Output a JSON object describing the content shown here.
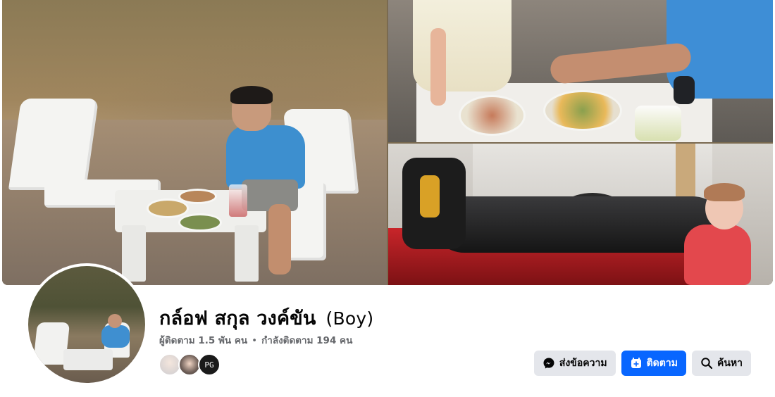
{
  "profile": {
    "name": "กล์อฟ สกุล วงค์ขัน",
    "alternate_name": "(Boy)",
    "followers_text": "ผู้ติดตาม 1.5 พัน คน",
    "separator": "•",
    "following_text": "กำลังติดตาม 194 คน"
  },
  "follower_avatars": [
    {
      "label": ""
    },
    {
      "label": ""
    },
    {
      "label": "PG"
    }
  ],
  "actions": {
    "message_label": "ส่งข้อความ",
    "follow_label": "ติดตาม",
    "search_label": "ค้นหา"
  },
  "colors": {
    "primary_blue": "#0866ff",
    "button_gray": "#e4e6eb",
    "secondary_text": "#65676b"
  },
  "icons": {
    "message": "messenger-icon",
    "follow": "follow-plus-icon",
    "search": "search-icon"
  }
}
